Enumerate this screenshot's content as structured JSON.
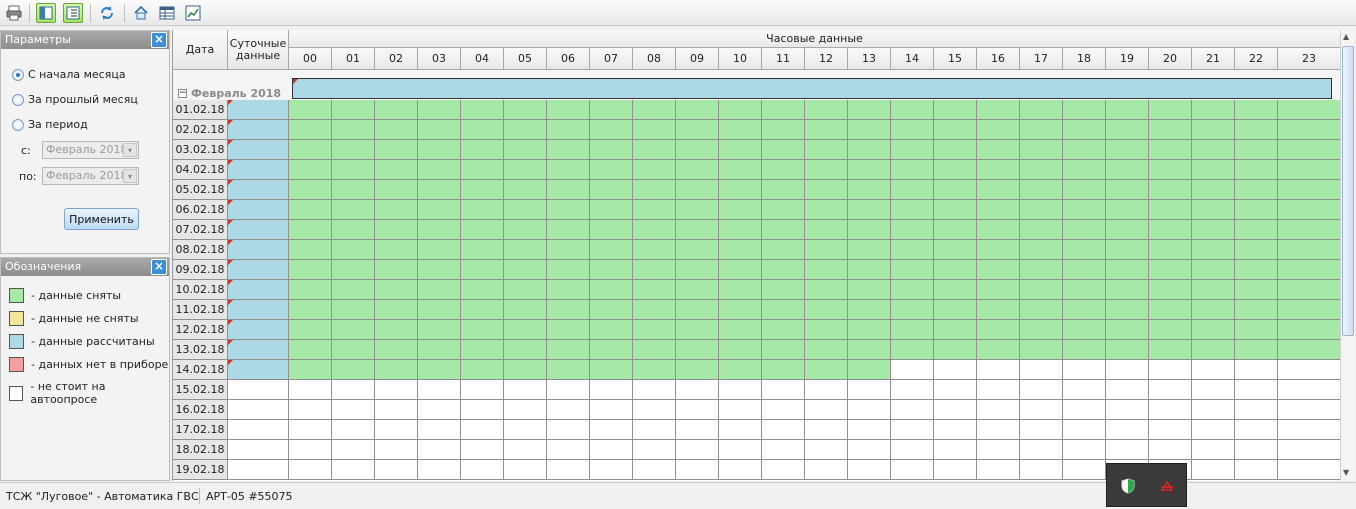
{
  "toolbar": {
    "buttons": [
      {
        "name": "print-icon",
        "active": false
      },
      {
        "name": "panel-left-icon",
        "active": true
      },
      {
        "name": "panel-right-icon",
        "active": true
      },
      {
        "name": "refresh-icon",
        "active": false
      },
      {
        "name": "home-icon",
        "active": false
      },
      {
        "name": "table-icon",
        "active": false
      },
      {
        "name": "chart-icon",
        "active": false
      }
    ]
  },
  "params_panel": {
    "title": "Параметры",
    "options": [
      {
        "label": "С начала месяца",
        "selected": true
      },
      {
        "label": "За прошлый месяц",
        "selected": false
      },
      {
        "label": "За период",
        "selected": false
      }
    ],
    "from_label": "с:",
    "from_value": "Февраль 2018",
    "to_label": "по:",
    "to_value": "Февраль 2018",
    "apply_label": "Применить"
  },
  "legend_panel": {
    "title": "Обозначения",
    "items": [
      {
        "color": "#a6e8a6",
        "label": "- данные сняты"
      },
      {
        "color": "#f0e6a0",
        "label": "- данные не сняты"
      },
      {
        "color": "#add8e6",
        "label": "- данные рассчитаны"
      },
      {
        "color": "#f4a0a0",
        "label": "- данных нет в приборе"
      },
      {
        "color": "#ffffff",
        "label": "- не стоит на автоопросе"
      }
    ]
  },
  "grid": {
    "headers": {
      "date": "Дата",
      "daily": "Суточные данные",
      "hourly": "Часовые данные",
      "hours": [
        "00",
        "01",
        "02",
        "03",
        "04",
        "05",
        "06",
        "07",
        "08",
        "09",
        "10",
        "11",
        "12",
        "13",
        "14",
        "15",
        "16",
        "17",
        "18",
        "19",
        "20",
        "21",
        "22",
        "23"
      ]
    },
    "month_label": "Февраль 2018",
    "colors": {
      "taken": "#a6e8a6",
      "calculated": "#add8e6",
      "none": "#ffffff"
    },
    "rows": [
      {
        "date": "01.02.18",
        "daily": "calculated",
        "hours_taken": 24
      },
      {
        "date": "02.02.18",
        "daily": "calculated",
        "hours_taken": 24
      },
      {
        "date": "03.02.18",
        "daily": "calculated",
        "hours_taken": 24
      },
      {
        "date": "04.02.18",
        "daily": "calculated",
        "hours_taken": 24
      },
      {
        "date": "05.02.18",
        "daily": "calculated",
        "hours_taken": 24
      },
      {
        "date": "06.02.18",
        "daily": "calculated",
        "hours_taken": 24
      },
      {
        "date": "07.02.18",
        "daily": "calculated",
        "hours_taken": 24
      },
      {
        "date": "08.02.18",
        "daily": "calculated",
        "hours_taken": 24
      },
      {
        "date": "09.02.18",
        "daily": "calculated",
        "hours_taken": 24
      },
      {
        "date": "10.02.18",
        "daily": "calculated",
        "hours_taken": 24
      },
      {
        "date": "11.02.18",
        "daily": "calculated",
        "hours_taken": 24
      },
      {
        "date": "12.02.18",
        "daily": "calculated",
        "hours_taken": 24
      },
      {
        "date": "13.02.18",
        "daily": "calculated",
        "hours_taken": 24
      },
      {
        "date": "14.02.18",
        "daily": "calculated",
        "hours_taken": 14
      },
      {
        "date": "15.02.18",
        "daily": "none",
        "hours_taken": 0
      },
      {
        "date": "16.02.18",
        "daily": "none",
        "hours_taken": 0
      },
      {
        "date": "17.02.18",
        "daily": "none",
        "hours_taken": 0
      },
      {
        "date": "18.02.18",
        "daily": "none",
        "hours_taken": 0
      },
      {
        "date": "19.02.18",
        "daily": "none",
        "hours_taken": 0
      }
    ]
  },
  "statusbar": {
    "object": "ТСЖ \"Луговое\" - Автоматика ГВС",
    "device": "АРТ-05 #55075"
  },
  "tray": {
    "icons": [
      "shield-icon",
      "network-icon"
    ]
  }
}
